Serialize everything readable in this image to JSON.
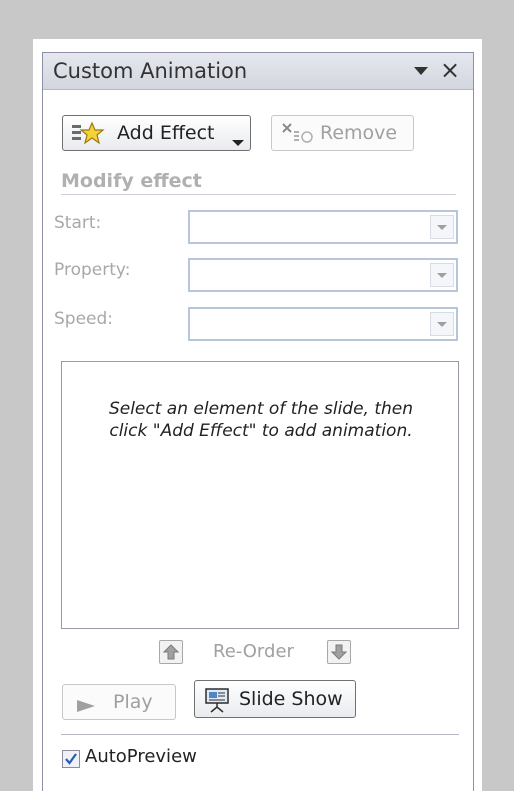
{
  "pane": {
    "title": "Custom Animation",
    "dropdown_icon": "triangle-down-icon",
    "close_symbol": "×"
  },
  "toolbar": {
    "add_effect_label": "Add Effect",
    "remove_label": "Remove"
  },
  "modify": {
    "section_label": "Modify effect",
    "start_label": "Start:",
    "property_label": "Property:",
    "speed_label": "Speed:",
    "start_value": "",
    "property_value": "",
    "speed_value": ""
  },
  "effects_list": {
    "hint": "Select an element of the slide, then click \"Add Effect\" to add animation."
  },
  "reorder": {
    "label": "Re-Order"
  },
  "playback": {
    "play_label": "Play",
    "slideshow_label": "Slide Show"
  },
  "autopreview": {
    "label": "AutoPreview",
    "checked": true
  },
  "colors": {
    "window_bg": "#c8c8c8",
    "titlebar": "#dcdfe7",
    "select_border": "#b8c6dc",
    "disabled_text": "#a8a8a8",
    "accent_check": "#2a5ab8"
  }
}
